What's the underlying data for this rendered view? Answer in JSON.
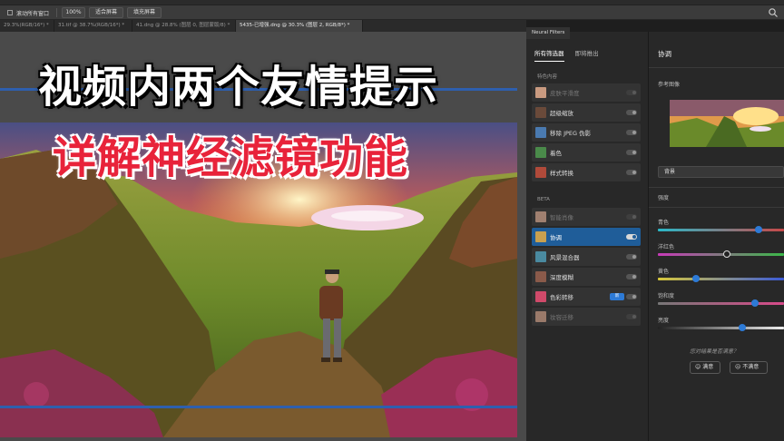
{
  "options": {
    "scroll_all_label": "滚动所有窗口",
    "zoom_100": "100%",
    "fit_screen": "适合屏幕",
    "fill_screen": "填充屏幕"
  },
  "doc_tabs": [
    {
      "label": "29.3%(RGB/16*) *"
    },
    {
      "label": "31.tif @ 38.7%(RGB/16*) *"
    },
    {
      "label": "41.dng @ 28.8% (图层 0, 图层蒙版/8) *"
    },
    {
      "label": "5435-已增强.dng @ 30.3% (图层 2, RGB/8*) *"
    }
  ],
  "overlay": {
    "line1": "视频内两个友情提示",
    "line2": "详解神经滤镜功能"
  },
  "panel": {
    "tab": "Neural Filters",
    "subtab_all": "所有筛选器",
    "subtab_soon": "即将推出",
    "featured_label": "特色内容",
    "beta_label": "BETA",
    "featured": [
      {
        "label": "皮肤平滑度",
        "toggle": "dim"
      },
      {
        "label": "超级缩放",
        "toggle": "off"
      },
      {
        "label": "移除 JPEG 伪影",
        "toggle": "off"
      },
      {
        "label": "着色",
        "toggle": "off"
      },
      {
        "label": "样式转换",
        "toggle": "off"
      }
    ],
    "beta": [
      {
        "label": "智能肖像",
        "toggle": "dim"
      },
      {
        "label": "协调",
        "toggle": "on"
      },
      {
        "label": "风景混合器",
        "toggle": "off"
      },
      {
        "label": "深度模糊",
        "toggle": "off"
      },
      {
        "label": "色彩转移",
        "toggle": "off",
        "badge": "新"
      },
      {
        "label": "妆容迁移",
        "toggle": "dim"
      }
    ],
    "right": {
      "title": "协调",
      "ref_label": "参考图像",
      "layer_select": "背景",
      "strength": "强度",
      "cyan": "青色",
      "magenta": "洋红色",
      "yellow": "黄色",
      "saturation": "饱和度",
      "brightness": "亮度",
      "feedback_q": "您对结果是否满意？",
      "satisfied": "满意",
      "unsatisfied": "不满意"
    }
  },
  "sliders": {
    "cyan_pos": 0.8,
    "magenta_pos": 0.55,
    "yellow_pos": 0.3,
    "saturation_pos": 0.77,
    "brightness_pos": 0.67
  },
  "colors": {
    "accent": "#1f5d99",
    "overlay_white": "#ffffff",
    "overlay_red": "#e8233a"
  }
}
